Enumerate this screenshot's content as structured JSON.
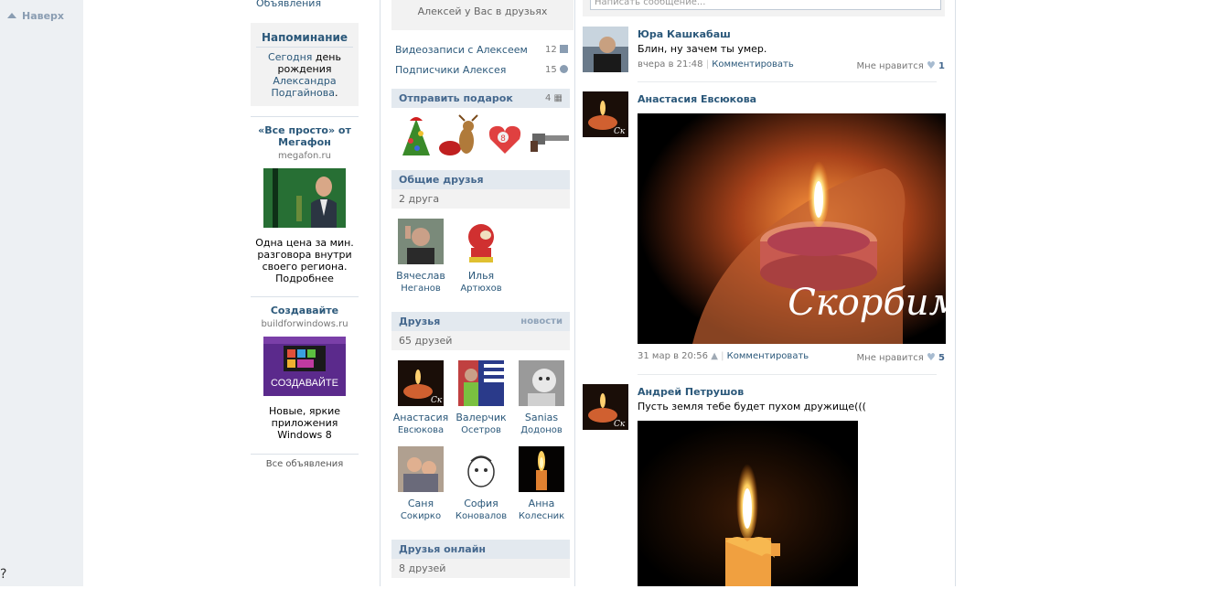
{
  "nav": {
    "to_top": "Наверх"
  },
  "ads": {
    "top_link": "Объявления",
    "reminder": {
      "title": "Напоминание",
      "pre": "Сегодня",
      "mid": " день рождения ",
      "name": "Александра Подгайнова",
      "post": "."
    },
    "items": [
      {
        "title": "«Все просто» от Мегафон",
        "domain": "megafon.ru",
        "desc": "Одна цена за мин. разговора внутри своего региона. Подробнее"
      },
      {
        "title": "Создавайте",
        "domain": "buildforwindows.ru",
        "banner_text": "СОЗДАВАЙТЕ",
        "desc": "Новые, яркие приложения Windows 8"
      }
    ],
    "all_ads": "Все объявления"
  },
  "profile": {
    "friend_status": "Алексей у Вас в друзьях",
    "links": [
      {
        "label": "Видеозаписи с Алексеем",
        "count": "12",
        "icon": "video-icon"
      },
      {
        "label": "Подписчики Алексея",
        "count": "15",
        "icon": "subscribers-icon"
      }
    ],
    "gift": {
      "title": "Отправить подарок",
      "count": "4"
    },
    "common": {
      "title": "Общие друзья",
      "count": "2 друга",
      "friends": [
        {
          "first": "Вячеслав",
          "last": "Неганов"
        },
        {
          "first": "Илья",
          "last": "Артюхов"
        }
      ]
    },
    "friends": {
      "title": "Друзья",
      "news": "новости",
      "count": "65 друзей",
      "list": [
        {
          "first": "Анастасия",
          "last": "Евсюкова"
        },
        {
          "first": "Валерчик",
          "last": "Осетров"
        },
        {
          "first": "Sanias",
          "last": "Додонов"
        },
        {
          "first": "Саня",
          "last": "Сокирко"
        },
        {
          "first": "София",
          "last": "Коновалов"
        },
        {
          "first": "Анна",
          "last": "Колесник"
        }
      ]
    },
    "online": {
      "title": "Друзья онлайн",
      "count": "8 друзей"
    }
  },
  "wall": {
    "composer_placeholder": "Написать сообщение...",
    "posts": [
      {
        "author": "Юра Кашкабаш",
        "text": "Блин, ну зачем ты умер.",
        "time": "вчера в 21:48",
        "comment": "Комментировать",
        "like_label": "Мне нравится",
        "likes": "1"
      },
      {
        "author": "Анастасия Евсюкова",
        "image_caption": "Скорбим",
        "time": "31 мар в 20:56",
        "comment": "Комментировать",
        "like_label": "Мне нравится",
        "likes": "5"
      },
      {
        "author": "Андрей Петрушов",
        "text": "Пусть земля тебе будет пухом дружище((("
      }
    ]
  },
  "colors": {
    "link": "#2b587a",
    "header_bg": "#e3e9ef",
    "gutter": "#edf0f3"
  }
}
